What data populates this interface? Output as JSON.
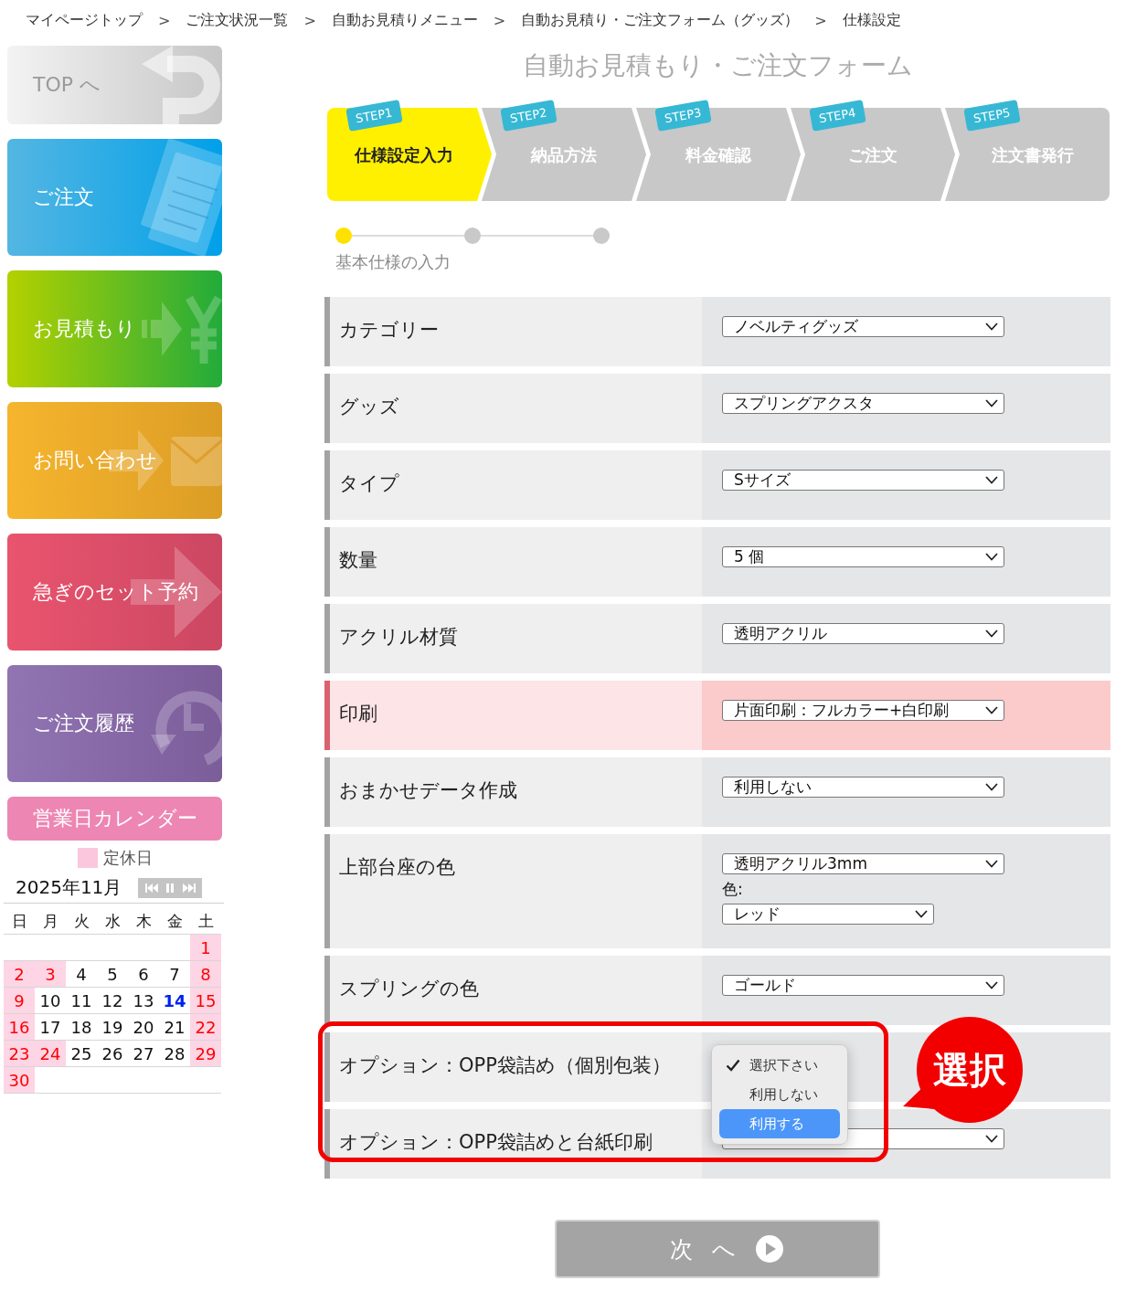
{
  "breadcrumb": [
    {
      "label": "マイページトップ",
      "separator": ">"
    },
    {
      "label": "ご注文状況一覧",
      "separator": ">"
    },
    {
      "label": "自動お見積りメニュー",
      "separator": ">"
    },
    {
      "label": "自動お見積り・ご注文フォーム（グッズ）",
      "separator": ">"
    },
    {
      "label": "仕様設定"
    }
  ],
  "sidebar": {
    "items": [
      {
        "kind": "top",
        "label": "TOP へ"
      },
      {
        "kind": "order",
        "label": "ご注文"
      },
      {
        "kind": "estimate",
        "label": "お見積もり"
      },
      {
        "kind": "contact",
        "label": "お問い合わせ"
      },
      {
        "kind": "reserve",
        "label": "急ぎのセット予約"
      },
      {
        "kind": "history",
        "label": "ご注文履歴"
      }
    ]
  },
  "calendar": {
    "title": "営業日カレンダー",
    "legend": "定休日",
    "month": "2025年11月",
    "weekdays": [
      "日",
      "月",
      "火",
      "水",
      "木",
      "金",
      "土"
    ],
    "weeks": [
      {
        "days": [
          {
            "day": "1",
            "holiday": true,
            "today": false
          }
        ]
      },
      {
        "days": [
          {
            "day": "2",
            "holiday": true,
            "today": false
          },
          {
            "day": "3",
            "holiday": true,
            "today": false
          },
          {
            "day": "4",
            "holiday": false,
            "today": false
          },
          {
            "day": "5",
            "holiday": false,
            "today": false
          },
          {
            "day": "6",
            "holiday": false,
            "today": false
          },
          {
            "day": "7",
            "holiday": false,
            "today": false
          },
          {
            "day": "8",
            "holiday": true,
            "today": false
          }
        ]
      },
      {
        "days": [
          {
            "day": "9",
            "holiday": true,
            "today": false
          },
          {
            "day": "10",
            "holiday": false,
            "today": false
          },
          {
            "day": "11",
            "holiday": false,
            "today": false
          },
          {
            "day": "12",
            "holiday": false,
            "today": false
          },
          {
            "day": "13",
            "holiday": false,
            "today": false
          },
          {
            "day": "14",
            "holiday": false,
            "today": true
          },
          {
            "day": "15",
            "holiday": true,
            "today": false
          }
        ]
      },
      {
        "days": [
          {
            "day": "16",
            "holiday": true,
            "today": false
          },
          {
            "day": "17",
            "holiday": false,
            "today": false
          },
          {
            "day": "18",
            "holiday": false,
            "today": false
          },
          {
            "day": "19",
            "holiday": false,
            "today": false
          },
          {
            "day": "20",
            "holiday": false,
            "today": false
          },
          {
            "day": "21",
            "holiday": false,
            "today": false
          },
          {
            "day": "22",
            "holiday": true,
            "today": false
          }
        ]
      },
      {
        "days": [
          {
            "day": "23",
            "holiday": true,
            "today": false
          },
          {
            "day": "24",
            "holiday": true,
            "today": false
          },
          {
            "day": "25",
            "holiday": false,
            "today": false
          },
          {
            "day": "26",
            "holiday": false,
            "today": false
          },
          {
            "day": "27",
            "holiday": false,
            "today": false
          },
          {
            "day": "28",
            "holiday": false,
            "today": false
          },
          {
            "day": "29",
            "holiday": true,
            "today": false
          }
        ]
      },
      {
        "days": [
          {
            "day": "30",
            "holiday": true,
            "today": false
          }
        ]
      }
    ]
  },
  "form": {
    "title": "自動お見積もり・ご注文フォーム",
    "steps": [
      {
        "badge": "STEP1",
        "label": "仕様設定入力",
        "selected": true
      },
      {
        "badge": "STEP2",
        "label": "納品方法",
        "selected": false
      },
      {
        "badge": "STEP3",
        "label": "料金確認",
        "selected": false
      },
      {
        "badge": "STEP4",
        "label": "ご注文",
        "selected": false
      },
      {
        "badge": "STEP5",
        "label": "注文書発行",
        "selected": false
      }
    ],
    "progress": {
      "dots": [
        {
          "selected": true
        },
        {
          "selected": false
        },
        {
          "selected": false
        }
      ],
      "label": "基本仕様の入力"
    },
    "rows": [
      {
        "label": "カテゴリー",
        "highlighted": false,
        "fields": [
          {
            "kind": "select",
            "value": "ノベルティグッズ"
          }
        ]
      },
      {
        "label": "グッズ",
        "highlighted": false,
        "fields": [
          {
            "kind": "select",
            "value": "スプリングアクスタ"
          }
        ]
      },
      {
        "label": "タイプ",
        "highlighted": false,
        "fields": [
          {
            "kind": "select",
            "value": "Sサイズ"
          }
        ]
      },
      {
        "label": "数量",
        "highlighted": false,
        "fields": [
          {
            "kind": "select",
            "value": "5 個"
          }
        ]
      },
      {
        "label": "アクリル材質",
        "highlighted": false,
        "fields": [
          {
            "kind": "select",
            "value": "透明アクリル"
          }
        ]
      },
      {
        "label": "印刷",
        "highlighted": true,
        "fields": [
          {
            "kind": "select",
            "value": "片面印刷：フルカラー+白印刷"
          }
        ]
      },
      {
        "label": "おまかせデータ作成",
        "highlighted": false,
        "fields": [
          {
            "kind": "select",
            "value": "利用しない"
          }
        ]
      },
      {
        "label": "上部台座の色",
        "highlighted": false,
        "fields": [
          {
            "kind": "select",
            "value": "透明アクリル3mm"
          },
          {
            "kind": "caption",
            "text": "色:"
          },
          {
            "kind": "short_select",
            "value": "レッド"
          }
        ]
      },
      {
        "label": "スプリングの色",
        "highlighted": false,
        "fields": [
          {
            "kind": "select",
            "value": "ゴールド"
          }
        ]
      },
      {
        "label": "オプション：OPP袋詰め（個別包装）",
        "highlighted": false,
        "fields": [
          {
            "kind": "menu",
            "options": [
              {
                "label": "選択下さい",
                "checked": true,
                "highlighted": false
              },
              {
                "label": "利用しない",
                "checked": false,
                "highlighted": false
              },
              {
                "label": "利用する",
                "checked": false,
                "highlighted": true
              }
            ]
          }
        ]
      },
      {
        "label": "オプション：OPP袋詰めと台紙印刷",
        "highlighted": false,
        "fields": [
          {
            "kind": "select"
          }
        ]
      }
    ],
    "next_button": "次 へ"
  },
  "annotation": {
    "label": "選択"
  }
}
